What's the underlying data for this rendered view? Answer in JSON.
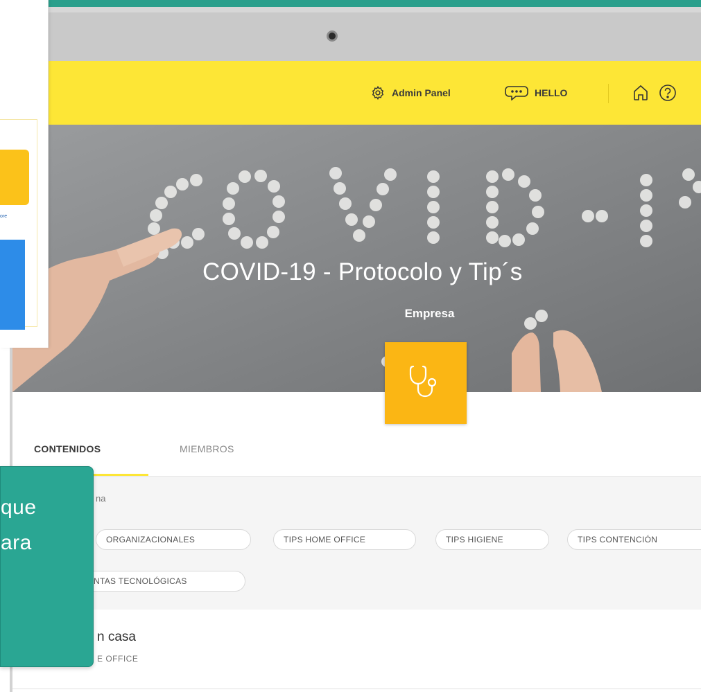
{
  "header": {
    "admin_label": "Admin Panel",
    "hello_label": "HELLO",
    "brand_color": "#fde636"
  },
  "banner": {
    "title": "COVID-19 - Protocolo y Tip´s",
    "subtitle": "Empresa",
    "badge_icon": "stethoscope-icon",
    "badge_color": "#fbb614"
  },
  "tabs": [
    {
      "label": "CONTENIDOS",
      "active": true
    },
    {
      "label": "MIEMBROS",
      "active": false
    }
  ],
  "filters": {
    "label_partial": "na",
    "chips": [
      "ORGANIZACIONALES",
      "TIPS HOME OFFICE",
      "TIPS HIGIENE",
      "TIPS CONTENCIÓN",
      "NTAS TECNOLÓGICAS"
    ]
  },
  "content": {
    "title_partial": "n casa",
    "category_partial": "E OFFICE"
  },
  "side_panel": {
    "small_text": "ore"
  },
  "callout": {
    "lines": [
      "que",
      "ara"
    ],
    "color": "#2aa693"
  }
}
